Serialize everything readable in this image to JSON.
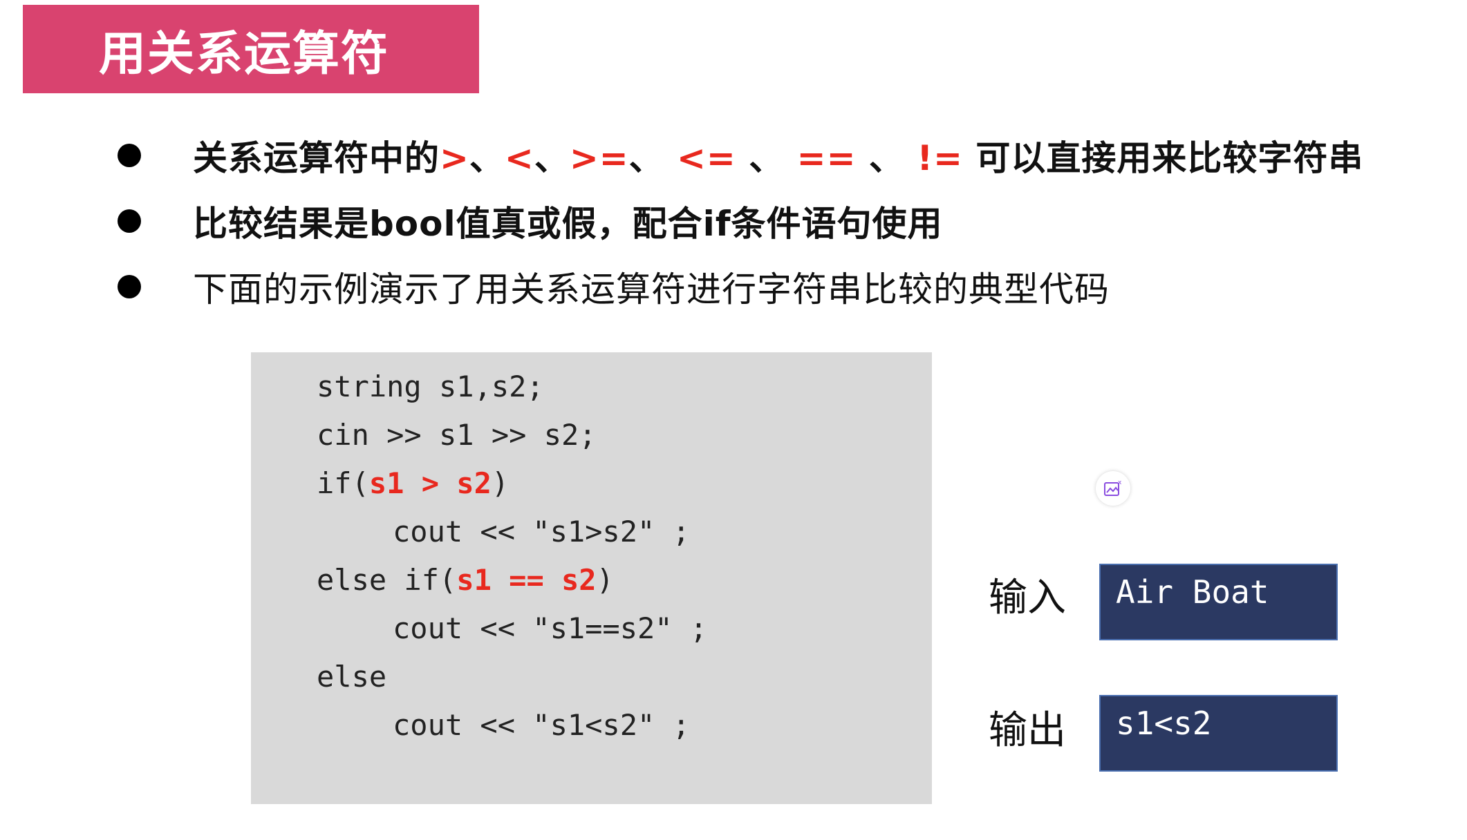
{
  "slide": {
    "title": "用关系运算符",
    "bullets": [
      {
        "prefix": "关系运算符中的",
        "ops": [
          ">",
          "<",
          ">=",
          "<=",
          "==",
          "!="
        ],
        "sep1": "、",
        "sep2": "、",
        "sep3": "、",
        "sep4": " 、",
        "sep5": " 、",
        "suffix": " 可以直接用来比较字符串"
      },
      {
        "text": "比较结果是bool值真或假，配合if条件语句使用"
      },
      {
        "text": "下面的示例演示了用关系运算符进行字符串比较的典型代码"
      }
    ],
    "code": {
      "line1": "string s1,s2;",
      "line2": "cin >> s1 >> s2;",
      "line3_pre": "if(",
      "line3_hl": "s1 > s2",
      "line3_post": ")",
      "line4": "cout << \"s1>s2\" ;",
      "line5_pre": "else if(",
      "line5_hl": "s1 == s2",
      "line5_post": ")",
      "line6": "cout << \"s1==s2\" ;",
      "line7": "else",
      "line8": "cout << \"s1<s2\" ;"
    },
    "io": {
      "input_label": "输入",
      "input_value": "Air Boat",
      "output_label": "输出",
      "output_value": "s1<s2"
    },
    "colors": {
      "title_bg": "#d9436f",
      "highlight": "#e8281e",
      "code_bg": "#d9d9d9",
      "io_bg": "#2b3962"
    },
    "icons": {
      "edit": "image-edit-icon"
    }
  }
}
